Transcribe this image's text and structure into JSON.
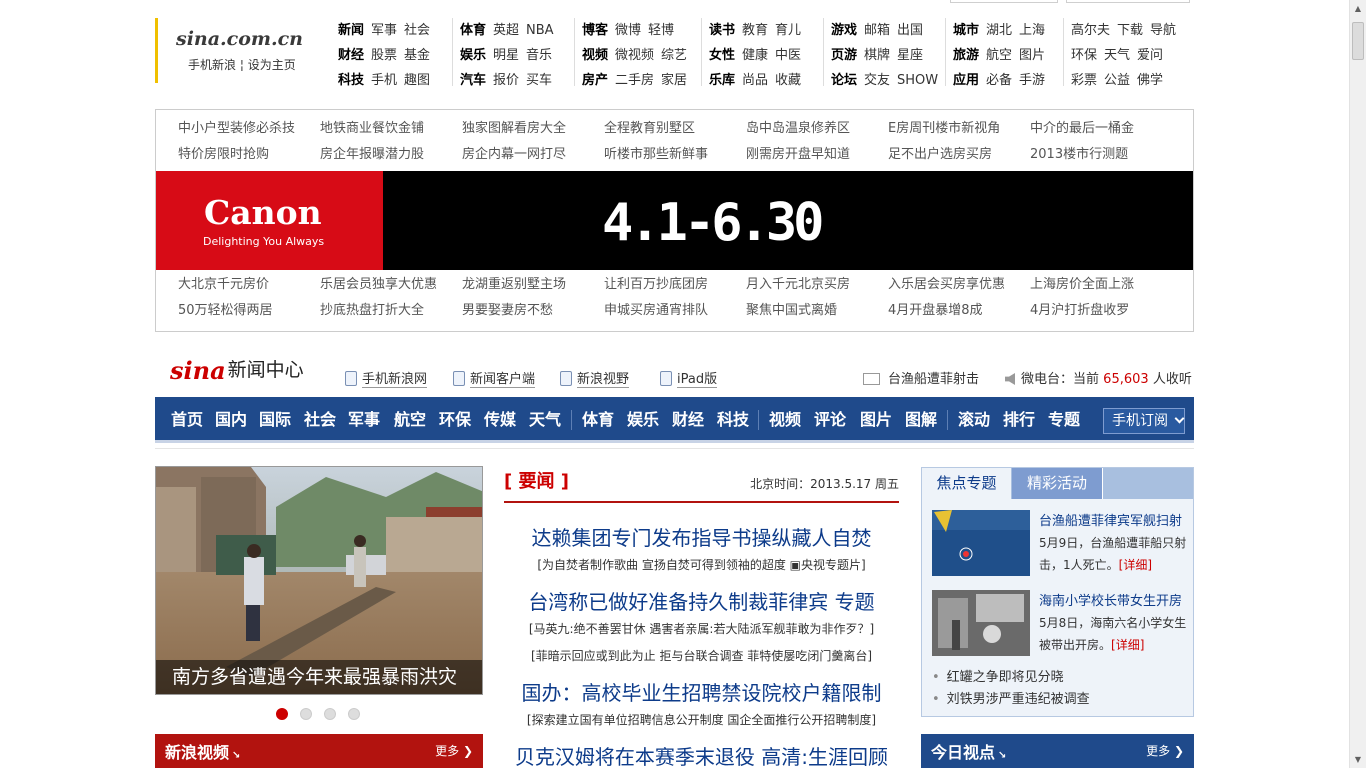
{
  "logo": {
    "text": "sina.com.cn",
    "links": [
      "手机新浪",
      "设为主页"
    ]
  },
  "topnav": {
    "groups": [
      [
        [
          "新闻",
          "军事",
          "社会"
        ],
        [
          "财经",
          "股票",
          "基金"
        ],
        [
          "科技",
          "手机",
          "趣图"
        ]
      ],
      [
        [
          "体育",
          "英超",
          "NBA"
        ],
        [
          "娱乐",
          "明星",
          "音乐"
        ],
        [
          "汽车",
          "报价",
          "买车"
        ]
      ],
      [
        [
          "博客",
          "微博",
          "轻博"
        ],
        [
          "视频",
          "微视频",
          "综艺"
        ],
        [
          "房产",
          "二手房",
          "家居"
        ]
      ],
      [
        [
          "读书",
          "教育",
          "育儿"
        ],
        [
          "女性",
          "健康",
          "中医"
        ],
        [
          "乐库",
          "尚品",
          "收藏"
        ]
      ],
      [
        [
          "游戏",
          "邮箱",
          "出国"
        ],
        [
          "页游",
          "棋牌",
          "星座"
        ],
        [
          "论坛",
          "交友",
          "SHOW"
        ]
      ],
      [
        [
          "城市",
          "湖北",
          "上海"
        ],
        [
          "旅游",
          "航空",
          "图片"
        ],
        [
          "应用",
          "必备",
          "手游"
        ]
      ],
      [
        [
          "高尔夫",
          "下载",
          "导航"
        ],
        [
          "环保",
          "天气",
          "爱问"
        ],
        [
          "彩票",
          "公益",
          "佛学"
        ]
      ]
    ]
  },
  "ad_links_top": [
    [
      "中小户型装修必杀技",
      "地铁商业餐饮金铺",
      "独家图解看房大全",
      "全程教育别墅区",
      "岛中岛温泉修养区",
      "E房周刊楼市新视角",
      "中介的最后一桶金"
    ],
    [
      "特价房限时抢购",
      "房企年报曝潜力股",
      "房企内幕一网打尽",
      "听楼市那些新鲜事",
      "刚需房开盘早知道",
      "足不出户选房买房",
      "2013楼市行测题"
    ]
  ],
  "canon_ad": {
    "brand": "Canon",
    "slogan": "Delighting You Always",
    "dates": "4.1-6.30"
  },
  "ad_links_bottom": [
    [
      "大北京千元房价",
      "乐居会员独享大优惠",
      "龙湖重返别墅主场",
      "让利百万抄底团房",
      "月入千元北京买房",
      "入乐居会买房享优惠",
      "上海房价全面上涨"
    ],
    [
      "50万轻松得两居",
      "抄底热盘打折大全",
      "男要娶妻房不愁",
      "申城买房通宵排队",
      "聚焦中国式离婚",
      "4月开盘暴增8成",
      "4月沪打折盘收罗"
    ]
  ],
  "news_center": {
    "logo_sina": "sina",
    "logo_title": "新闻中心",
    "tools": [
      "手机新浪网",
      "新闻客户端",
      "新浪视野",
      "iPad版"
    ],
    "headline_link": "台渔船遭菲射击",
    "weibo_label": "微电台：当前",
    "weibo_count": "65,603",
    "weibo_suffix": "人收听"
  },
  "main_nav": {
    "items": [
      "首页",
      "国内",
      "国际",
      "社会",
      "军事",
      "航空",
      "环保",
      "传媒",
      "天气",
      "体育",
      "娱乐",
      "财经",
      "科技",
      "视频",
      "评论",
      "图片",
      "图解",
      "滚动",
      "排行",
      "专题"
    ],
    "subscribe": "手机订阅"
  },
  "slideshow": {
    "caption": "南方多省遭遇今年来最强暴雨洪灾",
    "dots": 4,
    "active": 0
  },
  "video_bar": {
    "title": "新浪视频",
    "more": "更多"
  },
  "yaowen": {
    "title": "[ 要闻 ]",
    "date": "北京时间：2013.5.17 周五",
    "items": [
      {
        "headline": "达赖集团专门发布指导书操纵藏人自焚",
        "subs": [
          "[为自焚者制作歌曲 宣扬自焚可得到领袖的超度 ▣央视专题片]"
        ]
      },
      {
        "headline": "台湾称已做好准备持久制裁菲律宾 专题",
        "subs": [
          "[马英九:绝不善罢甘休 遇害者亲属:若大陆派军舰菲敢为非作歹？]",
          "[菲暗示回应或到此为止 拒与台联合调查 菲特使屡吃闭门羹离台]"
        ]
      },
      {
        "headline": "国办：高校毕业生招聘禁设院校户籍限制",
        "subs": [
          "[探索建立国有单位招聘信息公开制度 国企全面推行公开招聘制度]"
        ]
      },
      {
        "headline": "贝克汉姆将在本赛季末退役 高清:生涯回顾",
        "subs": []
      }
    ]
  },
  "focus": {
    "tabs": [
      "焦点专题",
      "精彩活动"
    ],
    "items": [
      {
        "title": "台渔船遭菲律宾军舰扫射",
        "desc": "5月9日，台渔船遭菲船只射击，1人死亡。",
        "detail": "[详细]"
      },
      {
        "title": "海南小学校长带女生开房",
        "desc": "5月8日，海南六名小学女生被带出开房。",
        "detail": "[详细]"
      }
    ],
    "links": [
      "红罐之争即将见分晓",
      "刘铁男涉严重违纪被调查"
    ]
  },
  "today_bar": {
    "title": "今日视点",
    "more": "更多"
  }
}
